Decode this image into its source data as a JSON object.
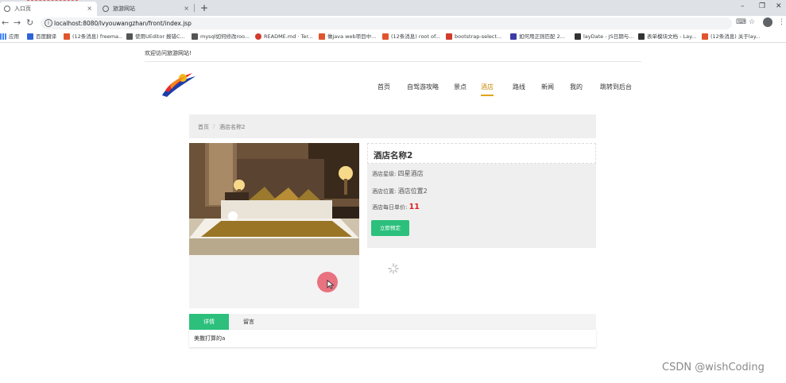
{
  "browser": {
    "tabs": [
      {
        "title": "入口页",
        "close": "×"
      },
      {
        "title": "旅游网站",
        "close": "×"
      }
    ],
    "new_tab": "+",
    "window_controls": [
      "–",
      "❐",
      "✕"
    ],
    "url": "localhost:8080/lvyouwangzhan/front/index.jsp",
    "bookmarks": [
      {
        "label": "应用",
        "color": "#4285f4"
      },
      {
        "label": "百度翻译",
        "color": "#2e63d8"
      },
      {
        "label": "(12条消息) freema...",
        "color": "#e0552d"
      },
      {
        "label": "使用UEditor 报错C...",
        "color": "#555555"
      },
      {
        "label": "mysql如何修改roo...",
        "color": "#555555"
      },
      {
        "label": "README.md · Ter...",
        "color": "#d23c2c"
      },
      {
        "label": "做java web项目中...",
        "color": "#e0552d"
      },
      {
        "label": "(12条消息) root of...",
        "color": "#e0552d"
      },
      {
        "label": "bootstrap-select...",
        "color": "#d23c2c"
      },
      {
        "label": "如何用正则匹配 2...",
        "color": "#3c3ca8"
      },
      {
        "label": "layDate - JS日期与...",
        "color": "#333333"
      },
      {
        "label": "表单模块文档 - Lay...",
        "color": "#333333"
      },
      {
        "label": "(12条消息) 关于lay...",
        "color": "#e0552d"
      }
    ]
  },
  "page": {
    "welcome": "欢迎访问旅游网站!",
    "nav": [
      "首页",
      "自驾游攻略",
      "景点",
      "酒店",
      "路线",
      "新闻",
      "我的",
      "跳转到后台"
    ],
    "active_nav": "酒店",
    "breadcrumb": {
      "home": "首页",
      "sep": "/",
      "current": "酒店名称2"
    },
    "hotel": {
      "name": "酒店名称2",
      "star_label": "酒店星级:",
      "star_value": "四星酒店",
      "location_label": "酒店位置:",
      "location_value": "酒店位置2",
      "price_label": "酒店每日单价:",
      "price_value": "11",
      "book_button": "立即预定"
    },
    "detail_tabs": [
      "详情",
      "留言"
    ],
    "detail_text": "美撒打算的a"
  },
  "watermark": "CSDN @wishCoding",
  "colors": {
    "accent_green": "#2cc07c",
    "nav_active": "#e2a31b",
    "price_red": "#e02020"
  }
}
